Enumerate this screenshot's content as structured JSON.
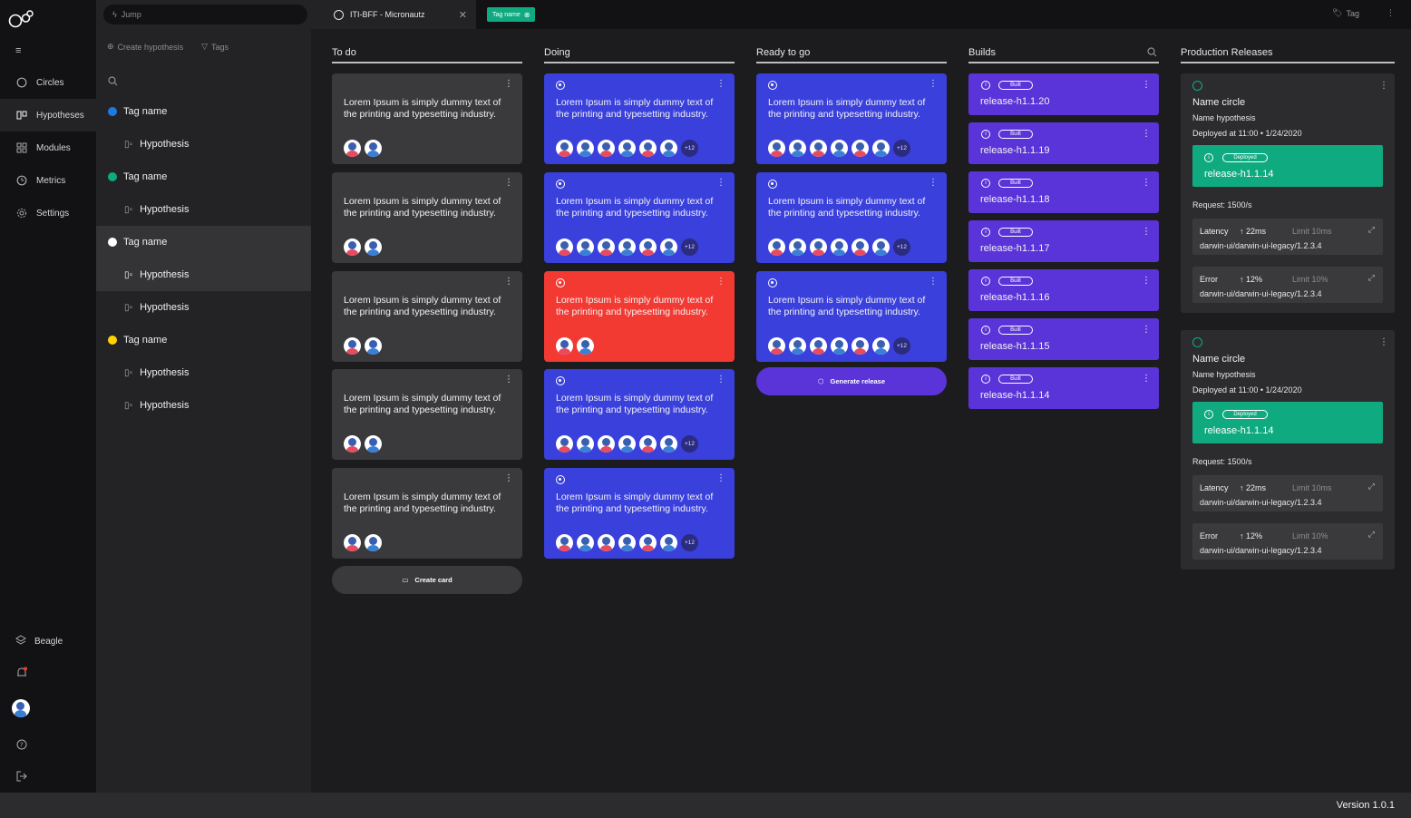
{
  "nav": {
    "items": [
      {
        "label": "Circles",
        "icon": "circle-icon"
      },
      {
        "label": "Hypotheses",
        "icon": "board-icon"
      },
      {
        "label": "Modules",
        "icon": "grid-icon"
      },
      {
        "label": "Metrics",
        "icon": "clock-icon"
      },
      {
        "label": "Settings",
        "icon": "gear-icon"
      }
    ],
    "workspace": "Beagle"
  },
  "sidebar": {
    "jump_placeholder": "Jump",
    "create_hypothesis": "Create hypothesis",
    "tags_filter": "Tags",
    "tags": [
      {
        "label": "Tag name",
        "color": "#1f7ae0",
        "hypotheses": [
          "Hypothesis"
        ]
      },
      {
        "label": "Tag name",
        "color": "#10aa80",
        "hypotheses": [
          "Hypothesis"
        ]
      },
      {
        "label": "Tag name",
        "color": "#ffffff",
        "hypotheses": [
          "Hypothesis",
          "Hypothesis"
        ]
      },
      {
        "label": "Tag name",
        "color": "#ffd200",
        "hypotheses": [
          "Hypothesis",
          "Hypothesis"
        ]
      }
    ]
  },
  "topbar": {
    "tab_title": "ITI-BFF - Micronautz",
    "tag_chip": "Tag name",
    "tag_button": "Tag"
  },
  "columns": {
    "todo": {
      "title": "To do",
      "create_label": "Create card"
    },
    "doing": {
      "title": "Doing"
    },
    "ready": {
      "title": "Ready to go",
      "generate_label": "Generate release"
    },
    "builds": {
      "title": "Builds"
    },
    "releases": {
      "title": "Production Releases"
    }
  },
  "card_text": "Lorem Ipsum is simply dummy text of the printing and typesetting industry.",
  "more_count": "+12",
  "builds": [
    {
      "badge": "Built",
      "label": "release-h1.1.20"
    },
    {
      "badge": "Built",
      "label": "release-h1.1.19"
    },
    {
      "badge": "Built",
      "label": "release-h1.1.18"
    },
    {
      "badge": "Built",
      "label": "release-h1.1.17"
    },
    {
      "badge": "Built",
      "label": "release-h1.1.16"
    },
    {
      "badge": "Built",
      "label": "release-h1.1.15"
    },
    {
      "badge": "Built",
      "label": "release-h1.1.14"
    }
  ],
  "releases": [
    {
      "circle": "Name circle",
      "hypothesis": "Name hypothesis",
      "deployed": "Deployed at 11:00 • 1/24/2020",
      "badge": "Deployed",
      "release": "release-h1.1.14",
      "request": "Request: 1500/s",
      "latency": {
        "label": "Latency",
        "value": "↑ 22ms",
        "limit": "Limit 10ms",
        "path": "darwin-ui/darwin-ui-legacy/1.2.3.4"
      },
      "error": {
        "label": "Error",
        "value": "↑ 12%",
        "limit": "Limit 10%",
        "path": "darwin-ui/darwin-ui-legacy/1.2.3.4"
      }
    },
    {
      "circle": "Name circle",
      "hypothesis": "Name hypothesis",
      "deployed": "Deployed at 11:00 • 1/24/2020",
      "badge": "Deployed",
      "release": "release-h1.1.14",
      "request": "Request: 1500/s",
      "latency": {
        "label": "Latency",
        "value": "↑ 22ms",
        "limit": "Limit 10ms",
        "path": "darwin-ui/darwin-ui-legacy/1.2.3.4"
      },
      "error": {
        "label": "Error",
        "value": "↑ 12%",
        "limit": "Limit 10%",
        "path": "darwin-ui/darwin-ui-legacy/1.2.3.4"
      }
    }
  ],
  "colors": {
    "accent_green": "#10aa80",
    "doing_blue": "#3a40dc",
    "build_purple": "#5a34d8",
    "danger_red": "#f23a33"
  },
  "footer": {
    "version": "Version 1.0.1"
  }
}
